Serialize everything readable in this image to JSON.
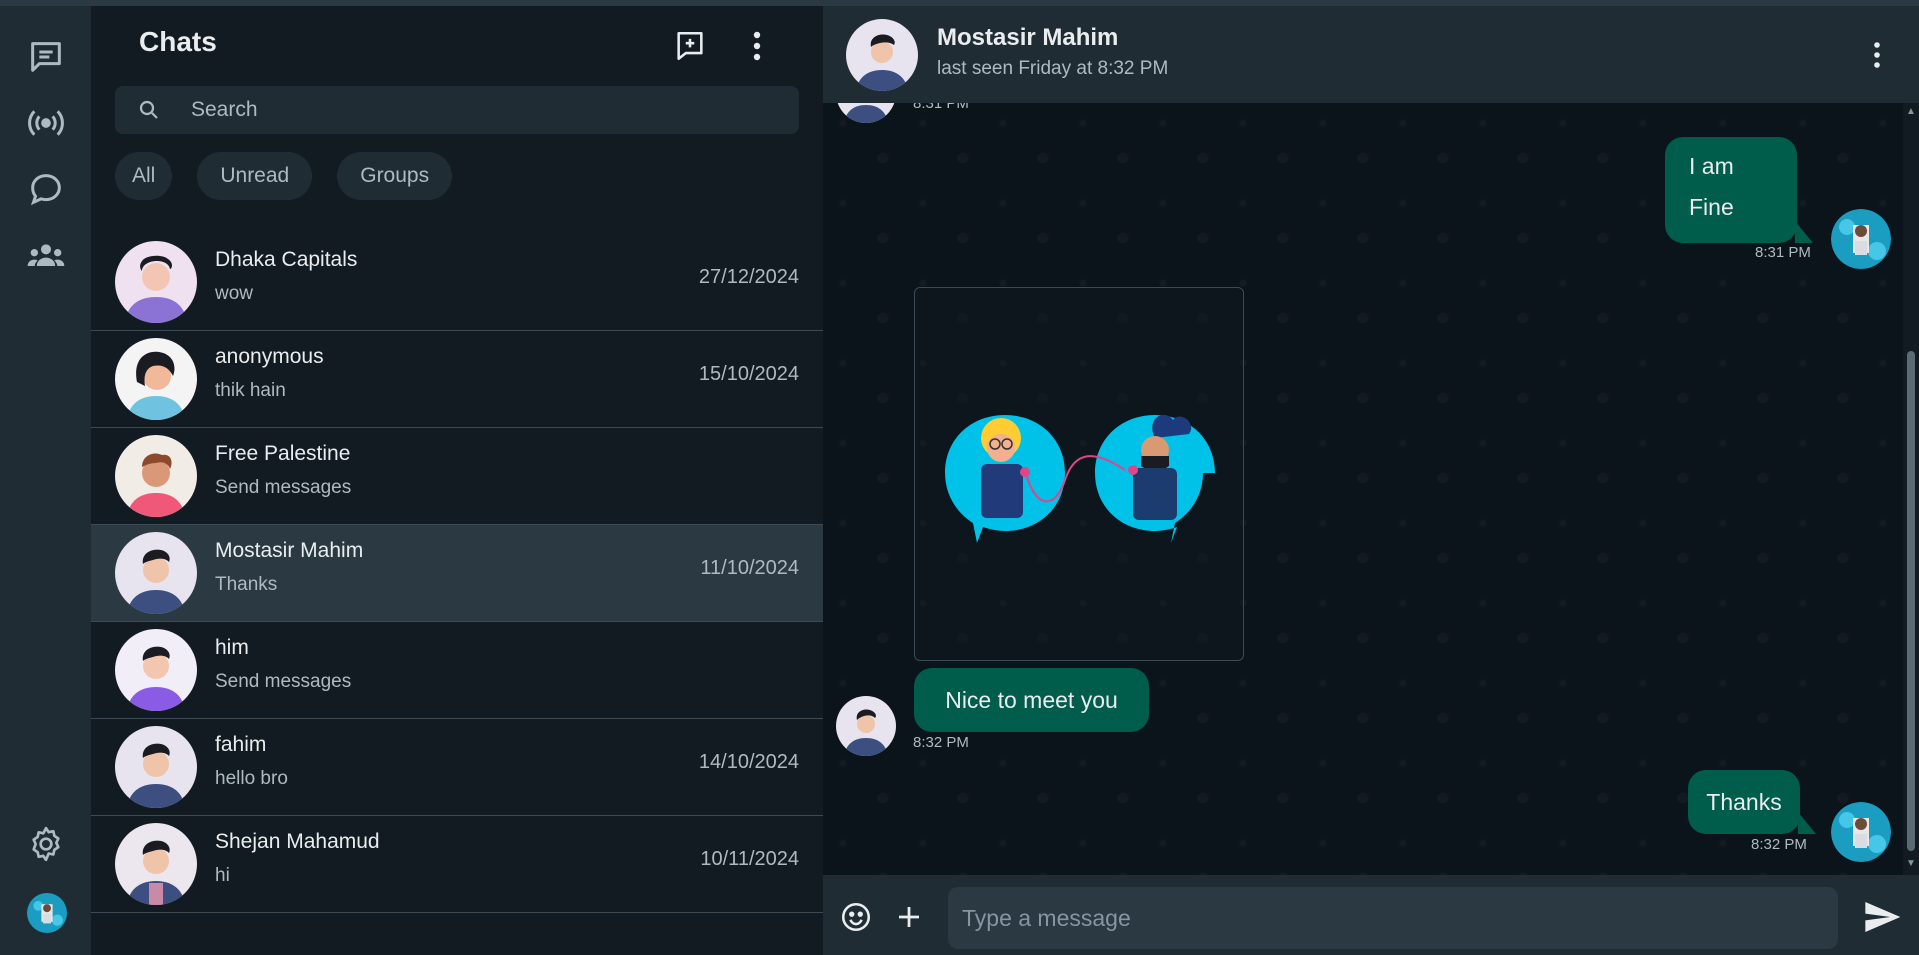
{
  "rail": {
    "icons": [
      "chats-icon",
      "status-icon",
      "channels-icon",
      "communities-icon",
      "settings-icon",
      "profile-avatar"
    ]
  },
  "left": {
    "title": "Chats",
    "search_placeholder": "Search",
    "filters": [
      "All",
      "Unread",
      "Groups"
    ],
    "chats": [
      {
        "name": "Dhaka Capitals",
        "preview": "wow",
        "date": "27/12/2024"
      },
      {
        "name": "anonymous",
        "preview": "thik hain",
        "date": "15/10/2024"
      },
      {
        "name": "Free Palestine",
        "preview": "Send messages",
        "date": ""
      },
      {
        "name": "Mostasir Mahim",
        "preview": "Thanks",
        "date": "11/10/2024"
      },
      {
        "name": "him",
        "preview": "Send messages",
        "date": ""
      },
      {
        "name": "fahim",
        "preview": "hello bro",
        "date": "14/10/2024"
      },
      {
        "name": "Shejan Mahamud",
        "preview": "hi",
        "date": "10/11/2024"
      }
    ]
  },
  "conversation": {
    "name": "Mostasir Mahim",
    "status": "last seen Friday at 8:32 PM",
    "messages": [
      {
        "from": "in",
        "text": "",
        "time": "8:31 PM"
      },
      {
        "from": "out",
        "text": "I am Fine",
        "line1": "I am",
        "line2": "Fine",
        "time": "8:31 PM"
      },
      {
        "from": "in",
        "text": "Nice to meet you",
        "time": "8:32 PM"
      },
      {
        "from": "out",
        "text": "Thanks",
        "time": "8:32 PM"
      }
    ],
    "input_placeholder": "Type a message"
  },
  "colors": {
    "accent": "#005c4b",
    "panel": "#202c33",
    "background": "#111b21"
  }
}
